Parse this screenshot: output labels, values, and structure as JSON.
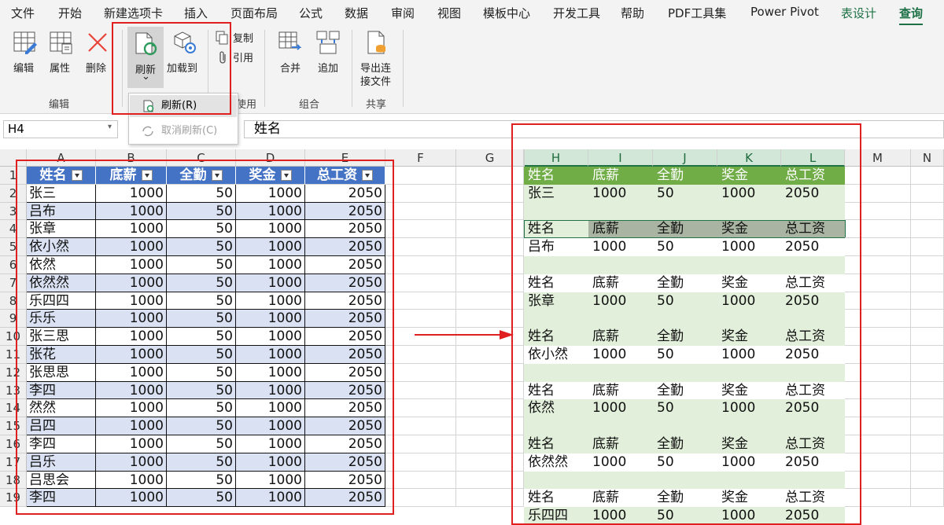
{
  "ribbon_tabs": [
    "文件",
    "开始",
    "新建选项卡",
    "插入",
    "页面布局",
    "公式",
    "数据",
    "审阅",
    "视图",
    "模板中心",
    "开发工具",
    "帮助",
    "PDF工具集",
    "Power Pivot",
    "表设计",
    "查询"
  ],
  "ribbon": {
    "edit_label": "编辑",
    "props_label": "属性",
    "delete_label": "删除",
    "refresh_label": "刷新",
    "refresh_caret": "⌄",
    "load_to_label": "加载到",
    "copy_label": "复制",
    "ref_label": "引用",
    "merge_label": "合并",
    "append_label": "追加",
    "export_label_1": "导出连",
    "export_label_2": "接文件",
    "group_edit": "编辑",
    "group_use": "使用",
    "group_combine": "组合",
    "group_share": "共享"
  },
  "refresh_menu": {
    "refresh": "刷新(R)",
    "cancel_refresh": "取消刷新(C)"
  },
  "formula_bar": {
    "name_box": "H4",
    "formula": "姓名"
  },
  "columns_left": [
    "A",
    "B",
    "C",
    "D",
    "E",
    "F",
    "G"
  ],
  "columns_right": [
    "H",
    "I",
    "J",
    "K",
    "L",
    "M",
    "N"
  ],
  "rows": [
    "1",
    "2",
    "3",
    "4",
    "5",
    "6",
    "7",
    "8",
    "9",
    "10",
    "11",
    "12",
    "13",
    "14",
    "15",
    "16",
    "17",
    "18",
    "19"
  ],
  "headers": [
    "姓名",
    "底薪",
    "全勤",
    "奖金",
    "总工资"
  ],
  "left_table": [
    [
      "张三",
      "1000",
      "50",
      "1000",
      "2050"
    ],
    [
      "吕布",
      "1000",
      "50",
      "1000",
      "2050"
    ],
    [
      "张章",
      "1000",
      "50",
      "1000",
      "2050"
    ],
    [
      "依小然",
      "1000",
      "50",
      "1000",
      "2050"
    ],
    [
      "依然",
      "1000",
      "50",
      "1000",
      "2050"
    ],
    [
      "依然然",
      "1000",
      "50",
      "1000",
      "2050"
    ],
    [
      "乐四四",
      "1000",
      "50",
      "1000",
      "2050"
    ],
    [
      "乐乐",
      "1000",
      "50",
      "1000",
      "2050"
    ],
    [
      "张三思",
      "1000",
      "50",
      "1000",
      "2050"
    ],
    [
      "张花",
      "1000",
      "50",
      "1000",
      "2050"
    ],
    [
      "张思思",
      "1000",
      "50",
      "1000",
      "2050"
    ],
    [
      "李四",
      "1000",
      "50",
      "1000",
      "2050"
    ],
    [
      "然然",
      "1000",
      "50",
      "1000",
      "2050"
    ],
    [
      "吕四",
      "1000",
      "50",
      "1000",
      "2050"
    ],
    [
      "李四",
      "1000",
      "50",
      "1000",
      "2050"
    ],
    [
      "吕乐",
      "1000",
      "50",
      "1000",
      "2050"
    ],
    [
      "吕思会",
      "1000",
      "50",
      "1000",
      "2050"
    ],
    [
      "李四",
      "1000",
      "50",
      "1000",
      "2050"
    ]
  ],
  "right_table": [
    [
      "姓名",
      "底薪",
      "全勤",
      "奖金",
      "总工资"
    ],
    [
      "张三",
      "1000",
      "50",
      "1000",
      "2050"
    ],
    [
      "",
      "",
      "",
      "",
      ""
    ],
    [
      "姓名",
      "底薪",
      "全勤",
      "奖金",
      "总工资"
    ],
    [
      "吕布",
      "1000",
      "50",
      "1000",
      "2050"
    ],
    [
      "",
      "",
      "",
      "",
      ""
    ],
    [
      "姓名",
      "底薪",
      "全勤",
      "奖金",
      "总工资"
    ],
    [
      "张章",
      "1000",
      "50",
      "1000",
      "2050"
    ],
    [
      "",
      "",
      "",
      "",
      ""
    ],
    [
      "姓名",
      "底薪",
      "全勤",
      "奖金",
      "总工资"
    ],
    [
      "依小然",
      "1000",
      "50",
      "1000",
      "2050"
    ],
    [
      "",
      "",
      "",
      "",
      ""
    ],
    [
      "姓名",
      "底薪",
      "全勤",
      "奖金",
      "总工资"
    ],
    [
      "依然",
      "1000",
      "50",
      "1000",
      "2050"
    ],
    [
      "",
      "",
      "",
      "",
      ""
    ],
    [
      "姓名",
      "底薪",
      "全勤",
      "奖金",
      "总工资"
    ],
    [
      "依然然",
      "1000",
      "50",
      "1000",
      "2050"
    ],
    [
      "",
      "",
      "",
      "",
      ""
    ],
    [
      "姓名",
      "底薪",
      "全勤",
      "奖金",
      "总工资"
    ],
    [
      "乐四四",
      "1000",
      "50",
      "1000",
      "2050"
    ]
  ],
  "colors": {
    "table_header": "#4472c4",
    "table_band": "#d9e1f2",
    "query_header": "#70ad47",
    "query_band": "#e2efda",
    "annotation": "#e02020",
    "accent": "#1e7145"
  }
}
